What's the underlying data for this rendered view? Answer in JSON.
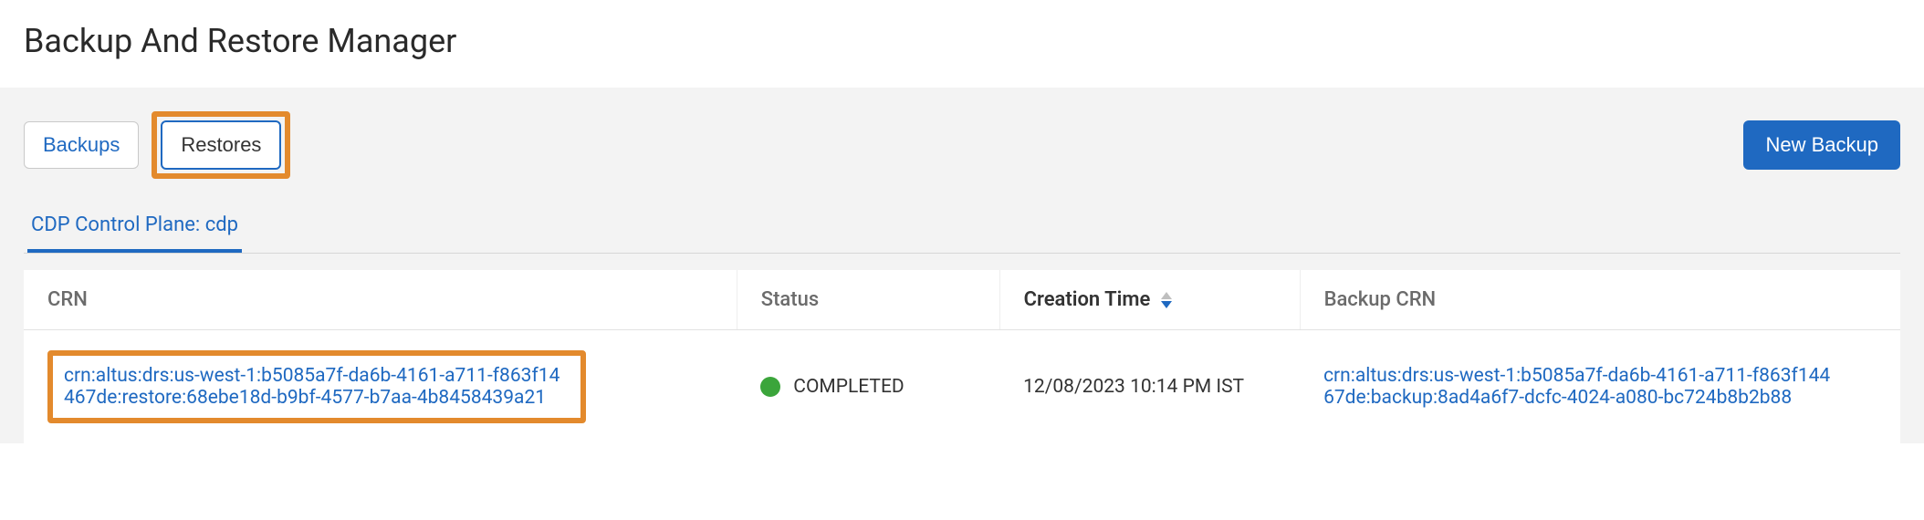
{
  "header": {
    "title": "Backup And Restore Manager"
  },
  "toolbar": {
    "backups_tab": "Backups",
    "restores_tab": "Restores",
    "new_backup_btn": "New Backup"
  },
  "sub_tabs": {
    "control_plane": "CDP Control Plane: cdp"
  },
  "table": {
    "columns": {
      "crn": "CRN",
      "status": "Status",
      "creation_time": "Creation Time",
      "backup_crn": "Backup CRN"
    },
    "rows": [
      {
        "crn": "crn:altus:drs:us-west-1:b5085a7f-da6b-4161-a711-f863f14467de:restore:68ebe18d-b9bf-4577-b7aa-4b8458439a21",
        "status": "COMPLETED",
        "creation_time": "12/08/2023 10:14 PM IST",
        "backup_crn": "crn:altus:drs:us-west-1:b5085a7f-da6b-4161-a711-f863f14467de:backup:8ad4a6f7-dcfc-4024-a080-bc724b8b2b88"
      }
    ]
  }
}
